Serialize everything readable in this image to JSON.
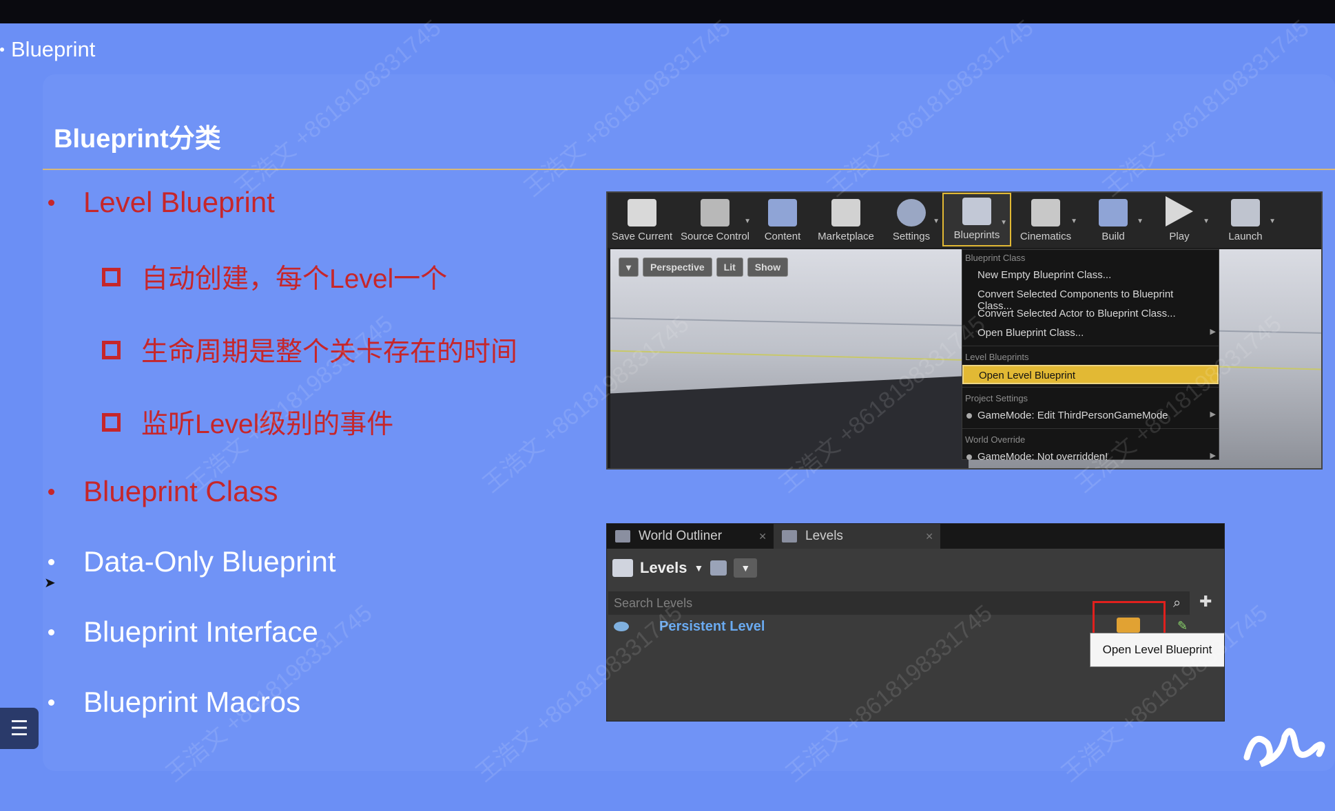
{
  "breadcrumb": "Blueprint",
  "slide": {
    "title": "Blueprint分类",
    "bullets": [
      {
        "text": "Level Blueprint"
      },
      {
        "text": "Blueprint Class"
      },
      {
        "text": "Data-Only Blueprint"
      },
      {
        "text": "Blueprint Interface"
      },
      {
        "text": "Blueprint Macros"
      }
    ],
    "level_sub": [
      "自动创建，每个Level一个",
      "生命周期是整个关卡存在的时间",
      "监听Level级别的事件"
    ]
  },
  "colors": {
    "bg": "#6b8ff5",
    "panel": "#7093f6",
    "accent_red": "#c6262a",
    "highlight": "#e2b934"
  },
  "ue_toolbar": {
    "buttons": [
      "Save Current",
      "Source Control",
      "Content",
      "Marketplace",
      "Settings",
      "Blueprints",
      "Cinematics",
      "Build",
      "Play",
      "Launch"
    ]
  },
  "viewport": {
    "buttons": [
      "Perspective",
      "Lit",
      "Show"
    ]
  },
  "blueprints_menu": {
    "sec_class": "Blueprint Class",
    "new_empty": "New Empty Blueprint Class...",
    "convert_comp": "Convert Selected Components to Blueprint Class...",
    "convert_actor": "Convert Selected Actor to Blueprint Class...",
    "open_class": "Open Blueprint Class...",
    "sec_level": "Level Blueprints",
    "open_level": "Open Level Blueprint",
    "sec_project": "Project Settings",
    "gamemode_edit": "GameMode: Edit ThirdPersonGameMode",
    "sec_world": "World Override",
    "gamemode_none": "GameMode: Not overridden!"
  },
  "levels_panel": {
    "tab_outliner": "World Outliner",
    "tab_levels": "Levels",
    "header": "Levels",
    "search_placeholder": "Search Levels",
    "row": "Persistent Level",
    "tooltip": "Open Level Blueprint"
  },
  "watermark": "王浩文 +8618198331745"
}
